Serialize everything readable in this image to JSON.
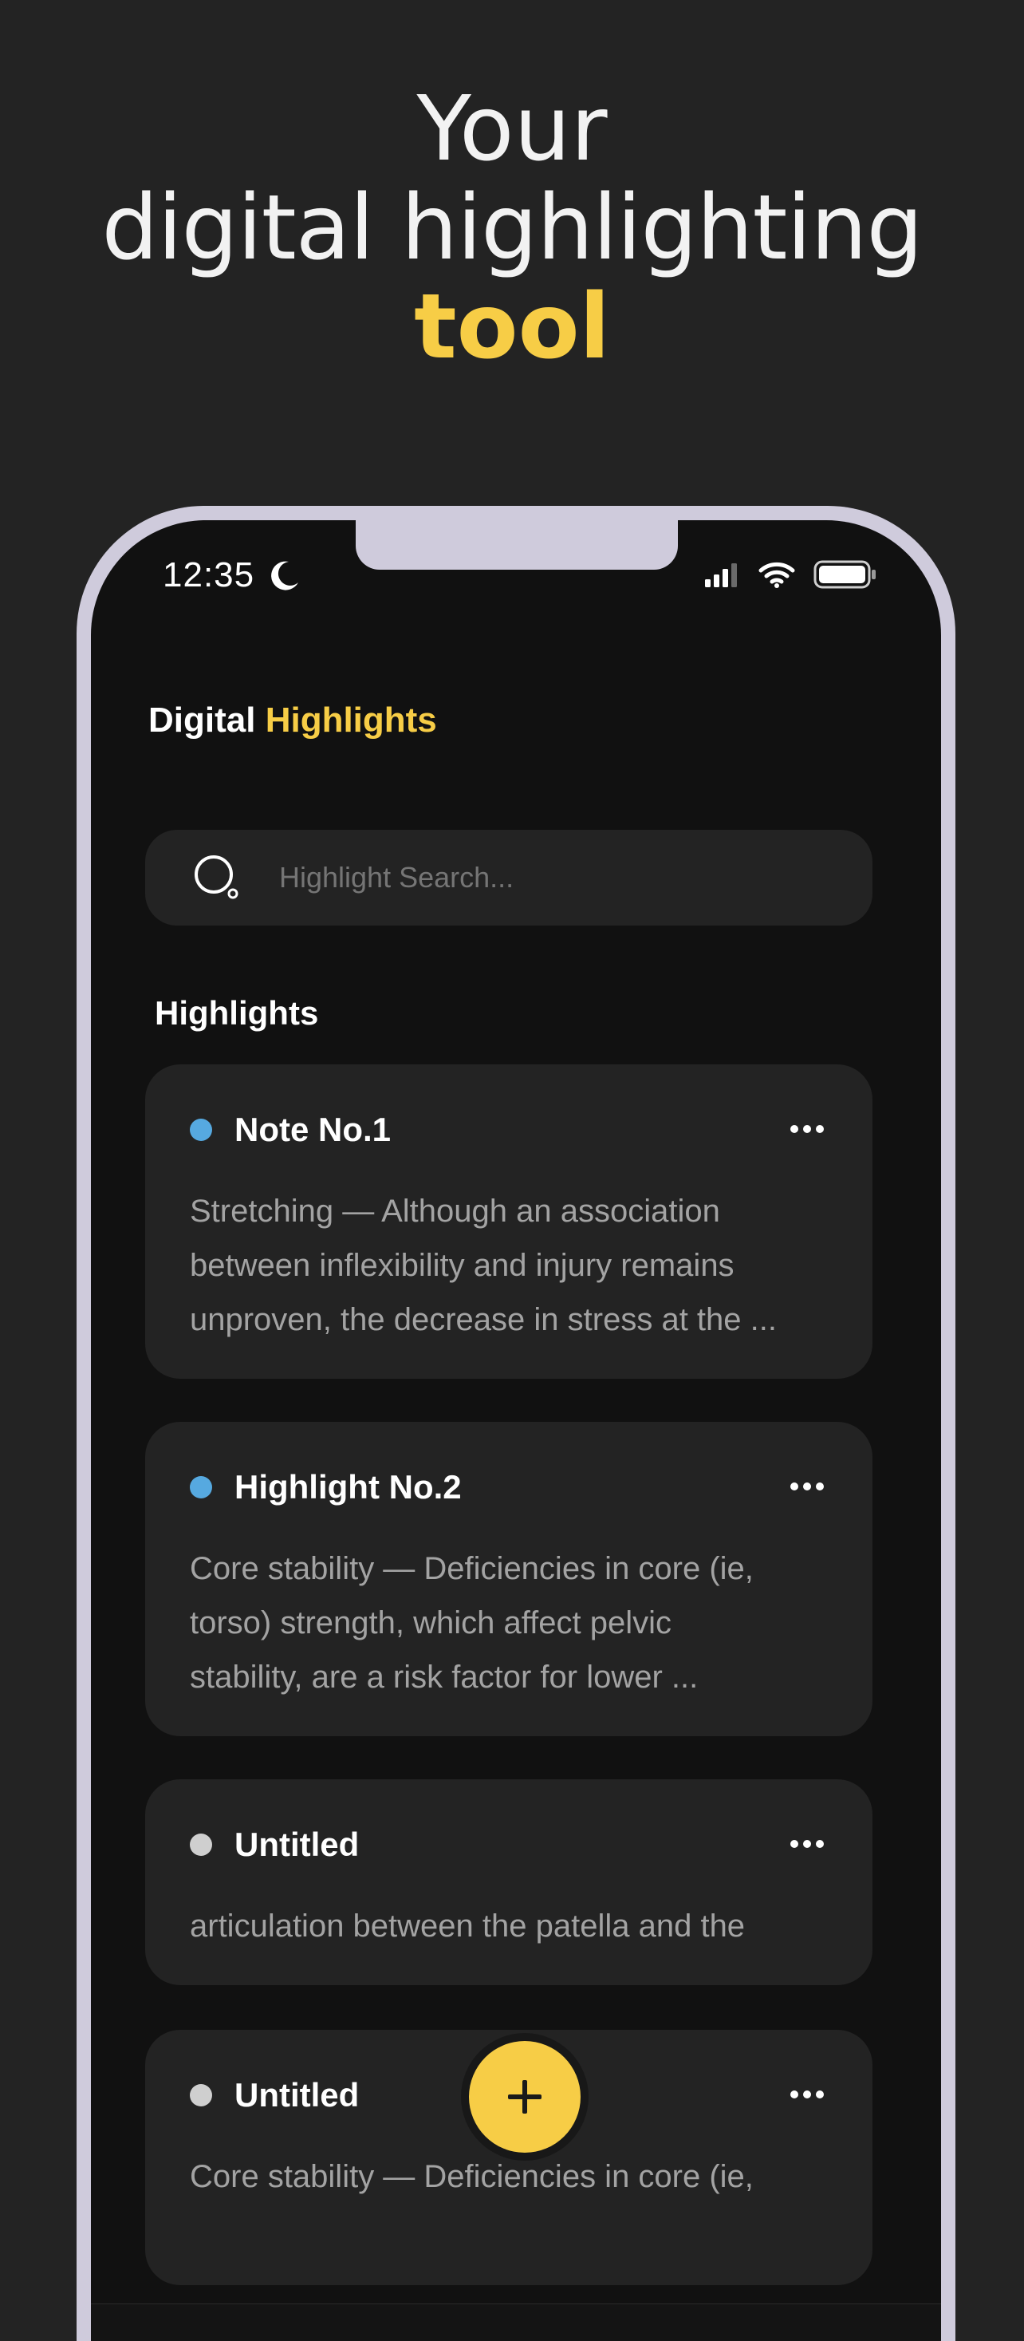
{
  "hero": {
    "line1": "Your",
    "line2": "digital highlighting",
    "line3": "tool"
  },
  "status_bar": {
    "time": "12:35"
  },
  "app": {
    "title_main": "Digital",
    "title_accent": "Highlights"
  },
  "search": {
    "placeholder": "Highlight Search..."
  },
  "section": {
    "title": "Highlights"
  },
  "notes": [
    {
      "title": "Note No.1",
      "dot_color": "#56a9e0",
      "lines": [
        "Stretching — Although an association",
        "between inflexibility and injury remains",
        "unproven, the decrease in stress at the ..."
      ]
    },
    {
      "title": "Highlight No.2",
      "dot_color": "#56a9e0",
      "lines": [
        "Core stability — Deficiencies in core (ie,",
        "torso) strength, which affect pelvic",
        "stability, are a risk factor for lower ..."
      ]
    },
    {
      "title": "Untitled",
      "dot_color": "#cfcfcf",
      "lines": [
        "articulation between the patella and the"
      ]
    },
    {
      "title": "Untitled",
      "dot_color": "#cfcfcf",
      "lines": [
        "Core stability — Deficiencies in core (ie,"
      ]
    }
  ],
  "colors": {
    "accent": "#f7cd46",
    "background": "#232323",
    "screen": "#111111",
    "card": "#232323",
    "frame": "#cfcbdc"
  },
  "icons": {
    "search": "search-icon",
    "more": "more-icon",
    "add": "plus-icon",
    "moon": "moon-icon",
    "signal": "signal-icon",
    "wifi": "wifi-icon",
    "battery": "battery-icon"
  }
}
